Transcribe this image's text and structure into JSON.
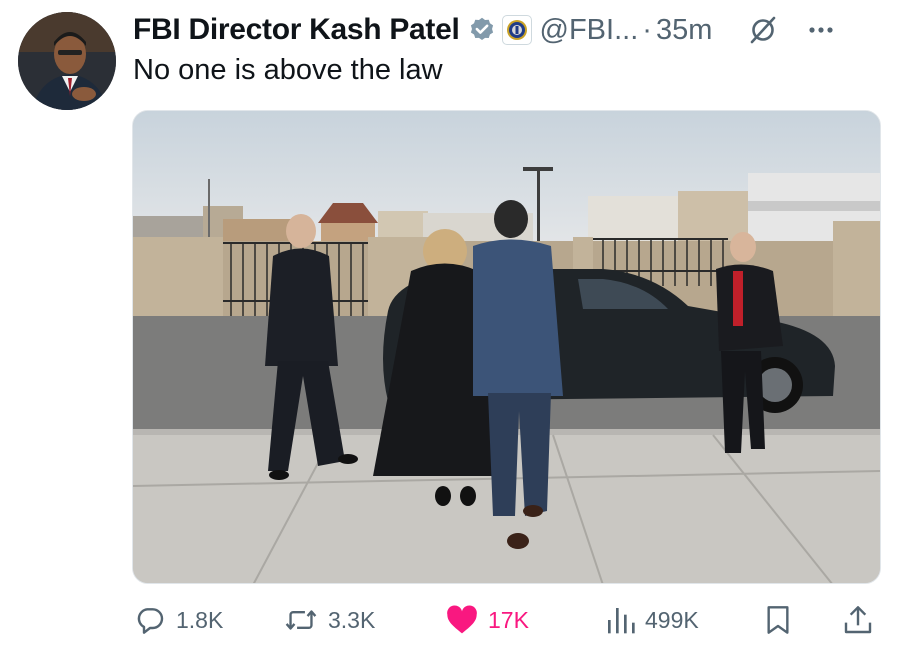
{
  "author": {
    "display_name": "FBI Director Kash Patel",
    "handle": "@FBI...",
    "separator": "·",
    "timestamp": "35m",
    "verified": true,
    "affiliation_badge": "fbi-seal-icon"
  },
  "tweet": {
    "text": "No one is above the law"
  },
  "actions": {
    "replies": "1.8K",
    "reposts": "3.3K",
    "likes": "17K",
    "views": "499K"
  },
  "colors": {
    "text": "#0f1419",
    "secondary": "#536471",
    "like": "#f91880",
    "verified": "#829aab"
  },
  "icons": {
    "reply": "reply-icon",
    "repost": "repost-icon",
    "like": "heart-icon",
    "views": "views-icon",
    "bookmark": "bookmark-icon",
    "share": "share-icon",
    "grok": "grok-icon",
    "more": "more-icon"
  }
}
